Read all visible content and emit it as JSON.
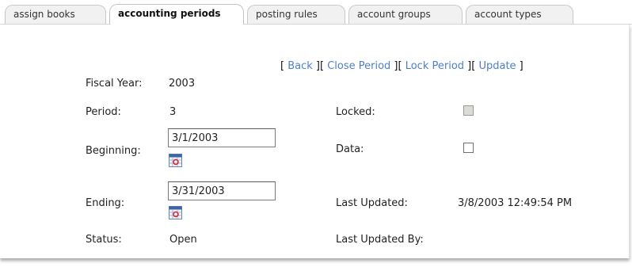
{
  "tabs": [
    {
      "label": "assign books"
    },
    {
      "label": "accounting periods",
      "active": true
    },
    {
      "label": "posting rules"
    },
    {
      "label": "account groups"
    },
    {
      "label": "account types"
    }
  ],
  "actions": {
    "open": "[ ",
    "back": "Back",
    "sep1": " ][ ",
    "close_period": "Close Period",
    "sep2": " ][ ",
    "lock_period": "Lock Period",
    "sep3": " ][ ",
    "update": "Update",
    "close": " ]"
  },
  "form": {
    "fiscal_year_label": "Fiscal Year:",
    "fiscal_year_value": "2003",
    "period_label": "Period:",
    "period_value": "3",
    "beginning_label": "Beginning:",
    "beginning_value": "3/1/2003",
    "ending_label": "Ending:",
    "ending_value": "3/31/2003",
    "status_label": "Status:",
    "status_value": "Open",
    "locked_label": "Locked:",
    "locked_checked": false,
    "data_label": "Data:",
    "data_checked": false,
    "last_updated_label": "Last Updated:",
    "last_updated_value": "3/8/2003 12:49:54 PM",
    "last_updated_by_label": "Last Updated By:",
    "last_updated_by_value": ""
  },
  "colors": {
    "link": "#4f7fc6",
    "tab_bg": "#f1f1f1",
    "disabled_checkbox": "#dcdcd6"
  },
  "icons": {
    "calendar": "calendar-icon"
  }
}
